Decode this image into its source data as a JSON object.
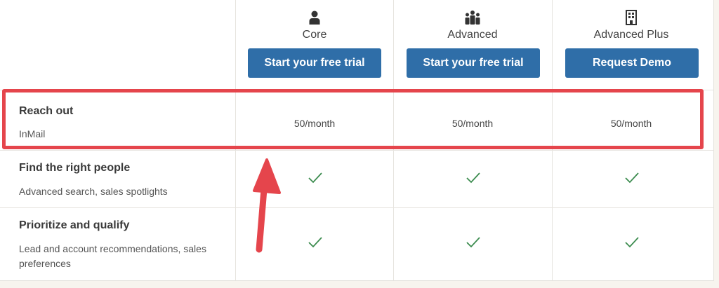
{
  "plans": [
    {
      "name": "Core",
      "cta": "Start your free trial",
      "icon": "person-icon"
    },
    {
      "name": "Advanced",
      "cta": "Start your free trial",
      "icon": "team-icon"
    },
    {
      "name": "Advanced Plus",
      "cta": "Request Demo",
      "icon": "building-icon"
    }
  ],
  "features": [
    {
      "title": "Reach out",
      "description": "InMail",
      "values": [
        "50/month",
        "50/month",
        "50/month"
      ]
    },
    {
      "title": "Find the right people",
      "description": "Advanced search, sales spotlights",
      "values": [
        "check",
        "check",
        "check"
      ]
    },
    {
      "title": "Prioritize and qualify",
      "description": "Lead and account recommendations, sales preferences",
      "values": [
        "check",
        "check",
        "check"
      ]
    }
  ],
  "colors": {
    "button": "#2f6ea8",
    "check": "#3c8c4f",
    "highlight": "#e5454c"
  }
}
